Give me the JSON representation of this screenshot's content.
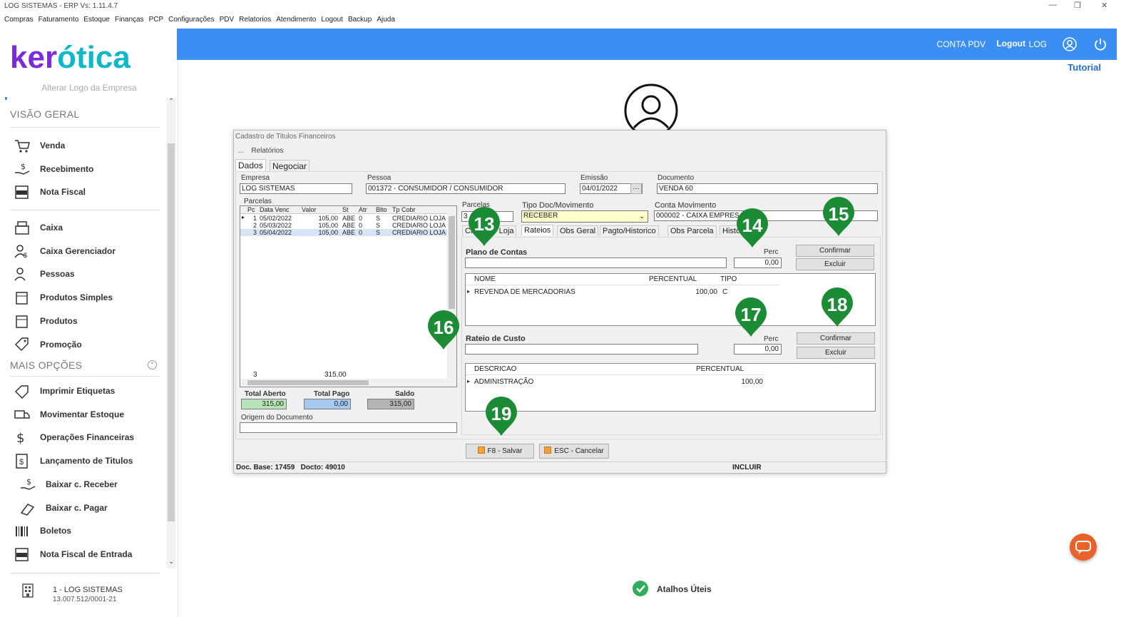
{
  "window": {
    "title": "LOG SISTEMAS - ERP Vs: 1.11.4.7"
  },
  "menu": [
    "Compras",
    "Faturamento",
    "Estoque",
    "Finanças",
    "PCP",
    "Configurações",
    "PDV",
    "Relatorios",
    "Atendimento",
    "Logout",
    "Backup",
    "Ajuda"
  ],
  "logo": {
    "text_a": "ker",
    "text_b": "ótica"
  },
  "sidebar": {
    "alter_logo": "Alterar Logo da Empresa",
    "section1": "VISÃO GERAL",
    "group1": [
      {
        "label": "Venda",
        "icon": "cart-icon"
      },
      {
        "label": "Recebimento",
        "icon": "hand-money-icon"
      },
      {
        "label": "Nota Fiscal",
        "icon": "nfe-icon"
      }
    ],
    "group2": [
      {
        "label": "Caixa",
        "icon": "register-icon"
      },
      {
        "label": "Caixa Gerenciador",
        "icon": "user-money-icon"
      },
      {
        "label": "Pessoas",
        "icon": "users-icon"
      },
      {
        "label": "Produtos Simples",
        "icon": "box-icon"
      },
      {
        "label": "Produtos",
        "icon": "box-icon"
      },
      {
        "label": "Promoção",
        "icon": "tag-icon"
      }
    ],
    "section2": "MAIS OPÇÕES",
    "group3": [
      {
        "label": "Imprimir Etiquetas",
        "icon": "label-icon"
      },
      {
        "label": "Movimentar Estoque",
        "icon": "truck-icon"
      },
      {
        "label": "Operações Financeiras",
        "icon": "dollar-icon"
      },
      {
        "label": "Lançamento de Titulos",
        "icon": "document-dollar-icon"
      }
    ],
    "group4": [
      {
        "label": "Baixar c. Receber",
        "icon": "hand-money-icon"
      },
      {
        "label": "Baixar c. Pagar",
        "icon": "pay-icon"
      }
    ],
    "group5": [
      {
        "label": "Boletos",
        "icon": "barcode-icon"
      },
      {
        "label": "Nota Fiscal de Entrada",
        "icon": "nfe-icon"
      }
    ],
    "company_name": "1 - LOG SISTEMAS",
    "company_cnpj": "13.007.512/0001-21"
  },
  "header": {
    "conta_pdv": "CONTA PDV",
    "logout": "Logout",
    "user": "LOG",
    "tutorial": "Tutorial"
  },
  "dialog": {
    "caption": "Cadastro de Titulos Financeiros",
    "menu": [
      "...",
      "Relatórios"
    ],
    "tabs": [
      "Dados",
      "Negociar"
    ],
    "empresa_label": "Empresa",
    "empresa": "LOG SISTEMAS",
    "pessoa_label": "Pessoa",
    "pessoa": "001372 - CONSUMIDOR / CONSUMIDOR",
    "emissao_label": "Emissão",
    "emissao": "04/01/2022",
    "documento_label": "Documento",
    "documento": "VENDA 60",
    "parcelas_label": "Parcelas",
    "parcelas_cols": [
      "Pc",
      "Data Venc",
      "Valor",
      "St",
      "Atr",
      "Blto",
      "Tp Cobr"
    ],
    "parcelas_rows": [
      [
        "1",
        "05/02/2022",
        "105,00",
        "ABE",
        "0",
        "S",
        "CREDIARIO LOJA"
      ],
      [
        "2",
        "05/03/2022",
        "105,00",
        "ABE",
        "0",
        "S",
        "CREDIARIO LOJA"
      ],
      [
        "3",
        "05/04/2022",
        "105,00",
        "ABE",
        "0",
        "S",
        "CREDIARIO LOJA"
      ]
    ],
    "parcelas_footer_count": "3",
    "parcelas_footer_total": "315,00",
    "total_aberto_label": "Total Aberto",
    "total_aberto": "315,00",
    "total_pago_label": "Total Pago",
    "total_pago": "0,00",
    "saldo_label": "Saldo",
    "saldo": "315,00",
    "origem_label": "Origem do Documento",
    "parcelas_field_label": "Parcelas",
    "parcelas_field": "3",
    "tipo_doc_label": "Tipo Doc/Movimento",
    "tipo_doc": "RECEBER",
    "conta_mov_label": "Conta Movimento",
    "conta_mov": "000002 - CAIXA EMPRESA",
    "inner_tabs": [
      "Crediário Loja",
      "Rateios",
      "Obs Geral",
      "Pagto/Historico",
      "Obs Parcela",
      "Historico"
    ],
    "plano_label": "Plano de Contas",
    "perc_label": "Perc",
    "perc1": "0,00",
    "confirmar": "Confirmar",
    "excluir": "Excluir",
    "plano_cols": [
      "NOME",
      "PERCENTUAL",
      "TIPO"
    ],
    "plano_rows": [
      [
        "REVENDA DE MERCADORIAS",
        "100,00",
        "C"
      ]
    ],
    "rateio_label": "Rateio de Custo",
    "perc2": "0,00",
    "rateio_cols": [
      "DESCRICAO",
      "PERCENTUAL"
    ],
    "rateio_rows": [
      [
        "ADMINISTRAÇÃO",
        "100,00"
      ]
    ],
    "salvar": "F8 - Salvar",
    "cancelar": "ESC - Cancelar",
    "status_doc": "Doc. Base: 17459   Docto: 49010",
    "status_mode": "INCLUIR"
  },
  "markers": [
    "13",
    "14",
    "15",
    "16",
    "17",
    "18",
    "19"
  ],
  "footer": {
    "atalhos": "Atalhos Úteis"
  }
}
